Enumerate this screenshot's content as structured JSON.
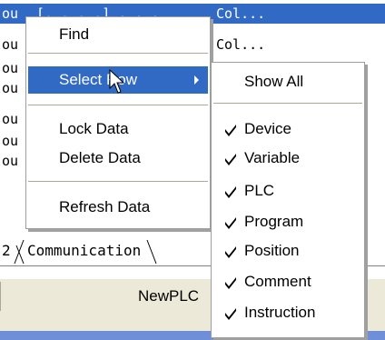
{
  "list": {
    "rows": [
      {
        "c1": "ou",
        "mid": "[. . . .]  . . .",
        "c2": "Col...",
        "selected": true
      },
      {
        "c1": "ou",
        "mid": "",
        "c2": "Col...",
        "selected": false
      },
      {
        "c1": "ou",
        "mid": "",
        "c2": "",
        "selected": false
      },
      {
        "c1": "ou",
        "mid": "",
        "c2": "",
        "selected": false
      },
      {
        "c1": "ou",
        "mid": "",
        "c2": "",
        "selected": false
      },
      {
        "c1": "ou",
        "mid": "",
        "c2": "",
        "selected": false
      },
      {
        "c1": "ou",
        "mid": "",
        "c2": "",
        "selected": false
      }
    ]
  },
  "tabs": {
    "tab_partial": "2",
    "tab_communication": "Communication"
  },
  "status": {
    "plc_name": "NewPLC"
  },
  "context_menu": {
    "find": "Find",
    "select_row": "Select Row",
    "lock_data": "Lock Data",
    "delete_data": "Delete Data",
    "refresh_data": "Refresh Data"
  },
  "submenu": {
    "show_all": "Show All",
    "items": [
      {
        "label": "Device",
        "checked": true
      },
      {
        "label": "Variable",
        "checked": true
      },
      {
        "label": "PLC",
        "checked": true
      },
      {
        "label": "Program",
        "checked": true
      },
      {
        "label": "Position",
        "checked": true
      },
      {
        "label": "Comment",
        "checked": true
      },
      {
        "label": "Instruction",
        "checked": true
      }
    ]
  },
  "colors": {
    "highlight": "#316ac5",
    "panel": "#ece9d8"
  }
}
